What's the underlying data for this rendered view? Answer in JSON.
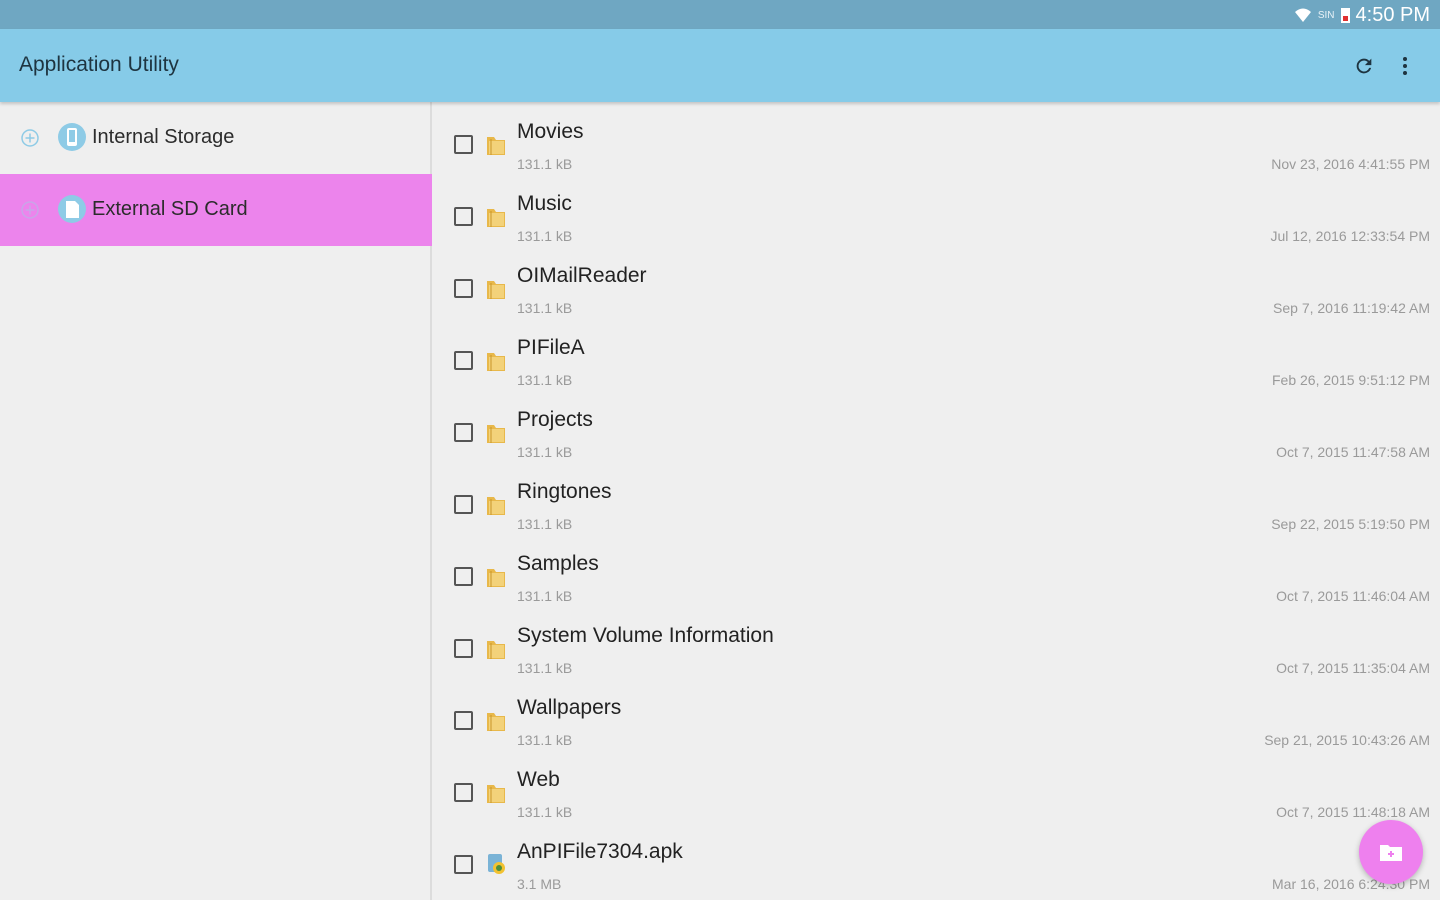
{
  "status_bar": {
    "time": "4:50 PM",
    "carrier": "SIN",
    "icons": [
      "wifi-icon",
      "sim-icon",
      "battery-low-icon"
    ]
  },
  "app_bar": {
    "title": "Application Utility",
    "actions": [
      {
        "name": "refresh",
        "icon": "refresh-icon"
      },
      {
        "name": "more-options",
        "icon": "more-vert-icon"
      }
    ]
  },
  "sidebar": {
    "items": [
      {
        "label": "Internal Storage",
        "icon": "internal-storage-icon",
        "selected": false
      },
      {
        "label": "External SD Card",
        "icon": "sd-card-icon",
        "selected": true
      }
    ]
  },
  "files": [
    {
      "name": "Movies",
      "size": "131.1 kB",
      "date": "Nov 23, 2016 4:41:55 PM",
      "type": "folder"
    },
    {
      "name": "Music",
      "size": "131.1 kB",
      "date": "Jul 12, 2016 12:33:54 PM",
      "type": "folder"
    },
    {
      "name": "OIMailReader",
      "size": "131.1 kB",
      "date": "Sep 7, 2016 11:19:42 AM",
      "type": "folder"
    },
    {
      "name": "PIFileA",
      "size": "131.1 kB",
      "date": "Feb 26, 2015 9:51:12 PM",
      "type": "folder"
    },
    {
      "name": "Projects",
      "size": "131.1 kB",
      "date": "Oct 7, 2015 11:47:58 AM",
      "type": "folder"
    },
    {
      "name": "Ringtones",
      "size": "131.1 kB",
      "date": "Sep 22, 2015 5:19:50 PM",
      "type": "folder"
    },
    {
      "name": "Samples",
      "size": "131.1 kB",
      "date": "Oct 7, 2015 11:46:04 AM",
      "type": "folder"
    },
    {
      "name": "System Volume Information",
      "size": "131.1 kB",
      "date": "Oct 7, 2015 11:35:04 AM",
      "type": "folder"
    },
    {
      "name": "Wallpapers",
      "size": "131.1 kB",
      "date": "Sep 21, 2015 10:43:26 AM",
      "type": "folder"
    },
    {
      "name": "Web",
      "size": "131.1 kB",
      "date": "Oct 7, 2015 11:48:18 AM",
      "type": "folder"
    },
    {
      "name": "AnPIFile7304.apk",
      "size": "3.1 MB",
      "date": "Mar 16, 2016 6:24:30 PM",
      "type": "apk"
    }
  ],
  "fab": {
    "icon": "new-folder-icon"
  },
  "colors": {
    "status_bar": "#6fa7c2",
    "app_bar": "#86cbe8",
    "accent": "#ec84ec",
    "folder": "#e8b84a"
  }
}
